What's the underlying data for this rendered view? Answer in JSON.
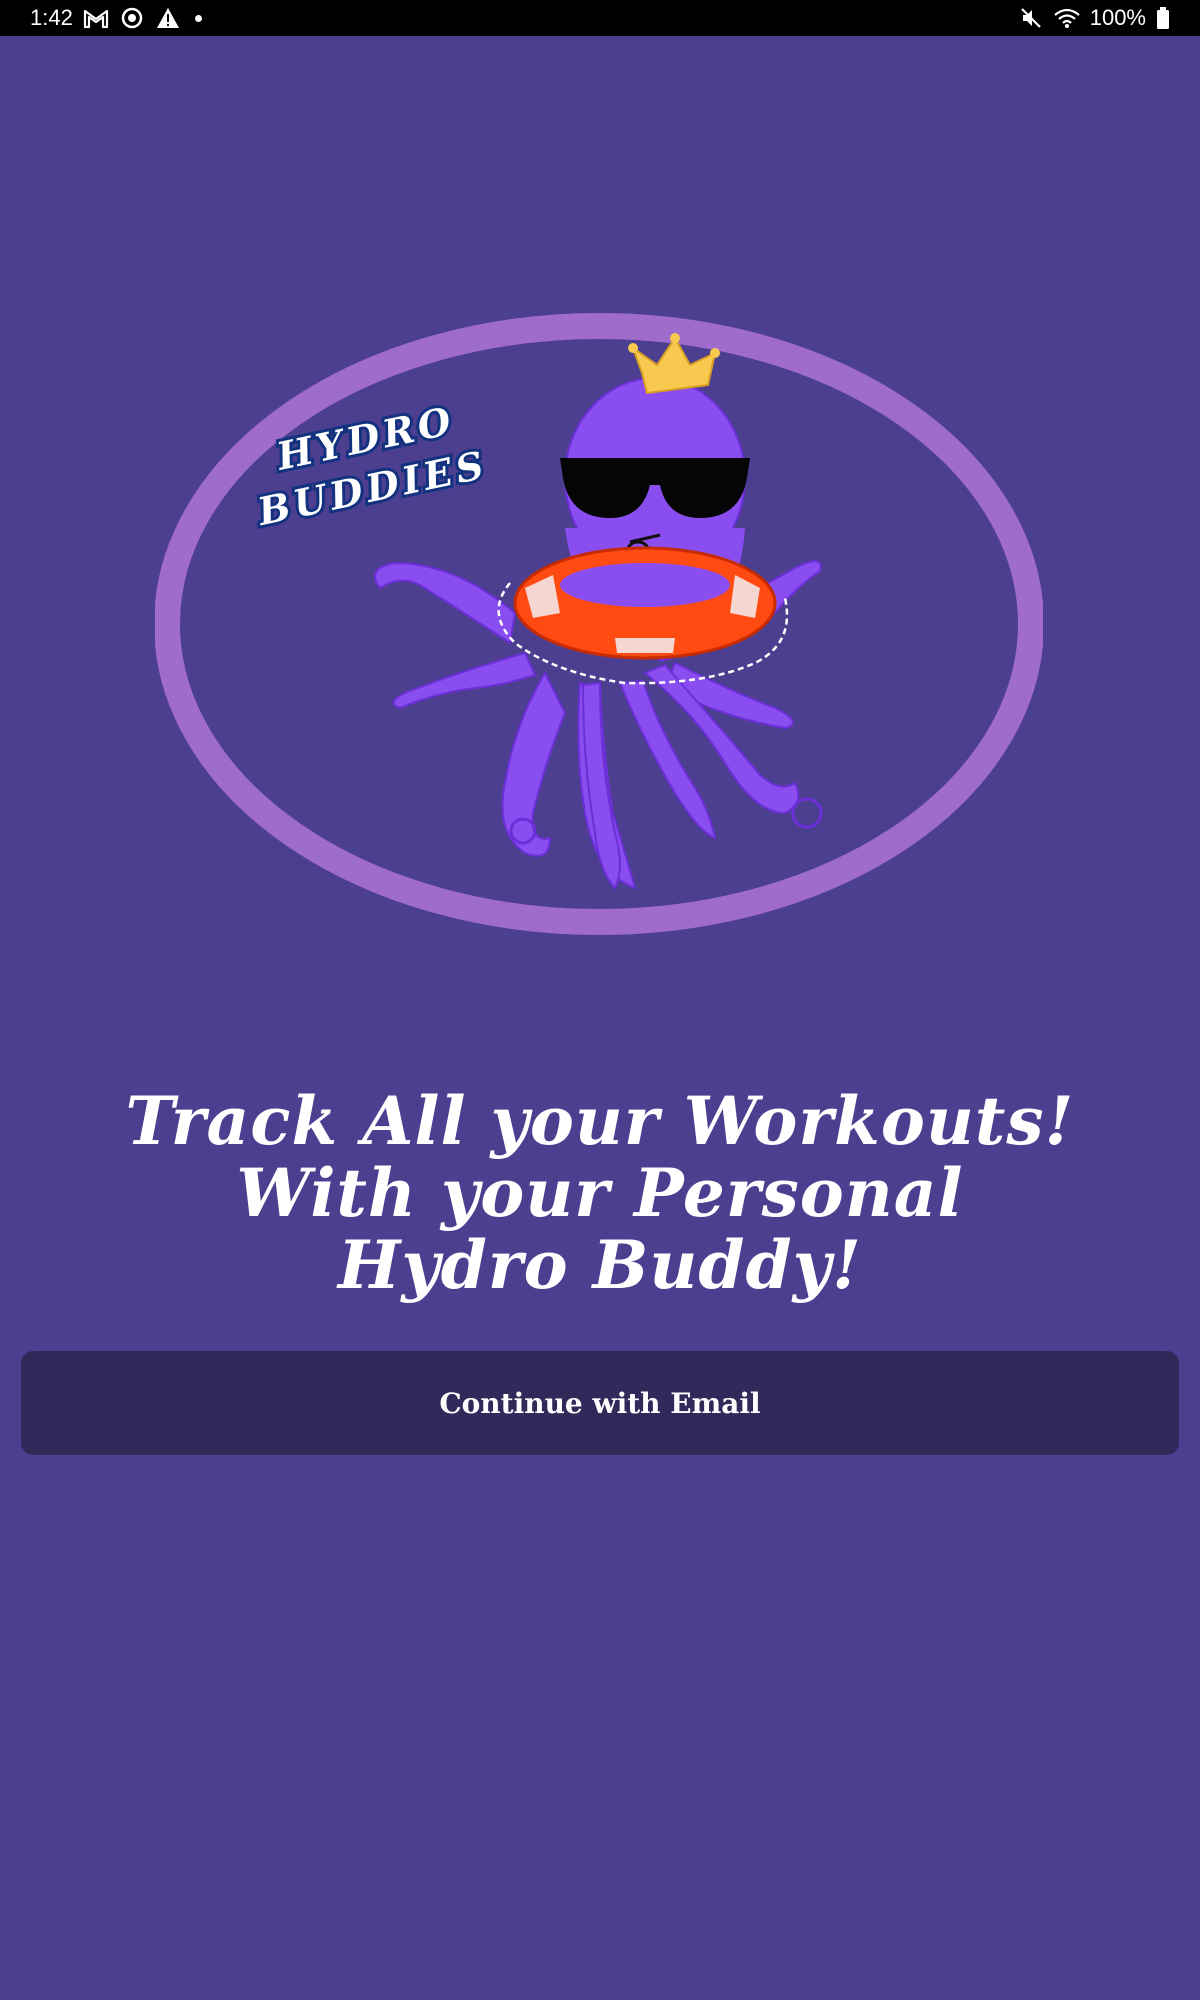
{
  "status_bar": {
    "time": "1:42",
    "battery_text": "100%",
    "left_icons": [
      "gmail-icon",
      "sync-icon",
      "warning-icon",
      "notification-dot"
    ],
    "right_icons": [
      "mute-icon",
      "wifi-icon",
      "battery-icon"
    ]
  },
  "hero": {
    "logo_text_line1": "HYDRO",
    "logo_text_line2": "BUDDIES",
    "mascot": "octopus-with-crown-sunglasses-lifebuoy",
    "oval_color": "#a06ccc",
    "octopus_color": "#8a4df0",
    "crown_color": "#f7c94f",
    "lifebuoy_color": "#ff4a12"
  },
  "headline": {
    "line1": "Track All your Workouts!",
    "line2": "With your Personal",
    "line3": "Hydro Buddy!"
  },
  "cta": {
    "label": "Continue with Email"
  },
  "colors": {
    "background": "#4d3f8f",
    "button": "#33285a",
    "text": "#ffffff"
  }
}
